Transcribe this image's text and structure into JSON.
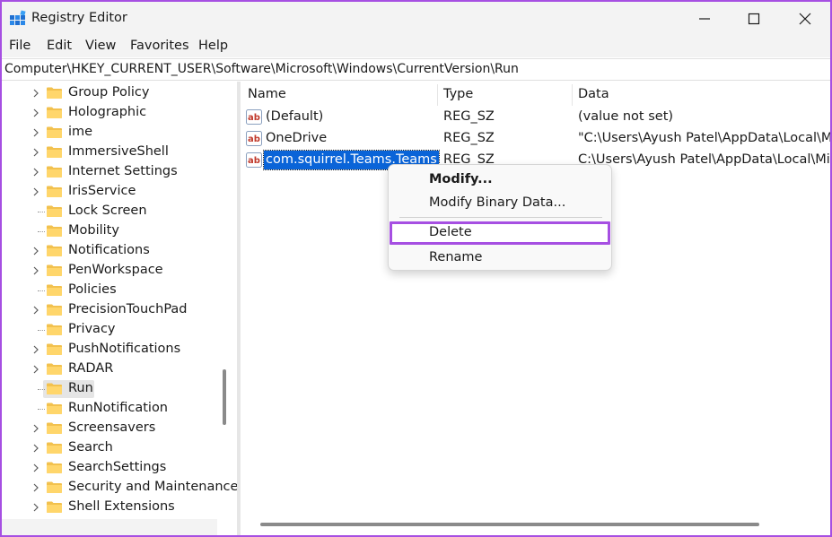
{
  "window": {
    "title": "Registry Editor",
    "accent": "#a64fe2",
    "controls": [
      "minimize-icon",
      "maximize-icon",
      "close-icon"
    ]
  },
  "menu": {
    "items": [
      "File",
      "Edit",
      "View",
      "Favorites",
      "Help"
    ]
  },
  "address": {
    "path": "Computer\\HKEY_CURRENT_USER\\Software\\Microsoft\\Windows\\CurrentVersion\\Run"
  },
  "tree": {
    "items": [
      {
        "label": "Group Policy",
        "expandable": true
      },
      {
        "label": "Holographic",
        "expandable": true
      },
      {
        "label": "ime",
        "expandable": true
      },
      {
        "label": "ImmersiveShell",
        "expandable": true
      },
      {
        "label": "Internet Settings",
        "expandable": true
      },
      {
        "label": "IrisService",
        "expandable": true
      },
      {
        "label": "Lock Screen",
        "expandable": false
      },
      {
        "label": "Mobility",
        "expandable": false
      },
      {
        "label": "Notifications",
        "expandable": true
      },
      {
        "label": "PenWorkspace",
        "expandable": true
      },
      {
        "label": "Policies",
        "expandable": false
      },
      {
        "label": "PrecisionTouchPad",
        "expandable": true
      },
      {
        "label": "Privacy",
        "expandable": false
      },
      {
        "label": "PushNotifications",
        "expandable": true
      },
      {
        "label": "RADAR",
        "expandable": true
      },
      {
        "label": "Run",
        "expandable": false,
        "selected": true
      },
      {
        "label": "RunNotification",
        "expandable": false
      },
      {
        "label": "Screensavers",
        "expandable": true
      },
      {
        "label": "Search",
        "expandable": true
      },
      {
        "label": "SearchSettings",
        "expandable": true
      },
      {
        "label": "Security and Maintenance",
        "expandable": true
      },
      {
        "label": "Shell Extensions",
        "expandable": true
      }
    ]
  },
  "list": {
    "columns": {
      "name": "Name",
      "type": "Type",
      "data": "Data"
    },
    "rows": [
      {
        "name": "(Default)",
        "type": "REG_SZ",
        "data": "(value not set)"
      },
      {
        "name": "OneDrive",
        "type": "REG_SZ",
        "data": "\"C:\\Users\\Ayush Patel\\AppData\\Local\\Micr"
      },
      {
        "name": "com.squirrel.Teams.Teams",
        "type": "REG_SZ",
        "data": "C:\\Users\\Ayush Patel\\AppData\\Local\\Micro",
        "selected": true
      }
    ]
  },
  "context_menu": {
    "items": [
      {
        "label": "Modify...",
        "bold": true
      },
      {
        "label": "Modify Binary Data..."
      },
      {
        "label": "Delete",
        "highlighted": true
      },
      {
        "label": "Rename"
      }
    ]
  }
}
